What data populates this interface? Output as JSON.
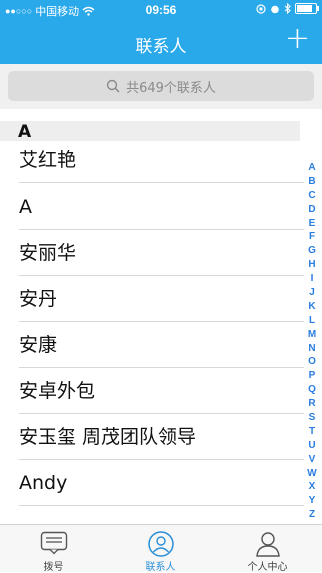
{
  "status_bar": {
    "signal": "●●○○○",
    "carrier": "中国移动",
    "time": "09:56"
  },
  "nav": {
    "title": "联系人",
    "add_label": "+"
  },
  "search": {
    "placeholder": "共649个联系人"
  },
  "section": {
    "letter": "A"
  },
  "contacts": [
    "艾红艳",
    "A",
    "安丽华",
    "安丹",
    "安康",
    "安卓外包",
    "安玉玺 周茂团队领导",
    "Andy"
  ],
  "index_letters": [
    "A",
    "B",
    "C",
    "D",
    "E",
    "F",
    "G",
    "H",
    "I",
    "J",
    "K",
    "L",
    "M",
    "N",
    "O",
    "P",
    "Q",
    "R",
    "S",
    "T",
    "U",
    "V",
    "W",
    "X",
    "Y",
    "Z",
    "#"
  ],
  "tabs": [
    {
      "label": "拨号",
      "icon": "dialpad-icon",
      "active": false
    },
    {
      "label": "联系人",
      "icon": "contacts-icon",
      "active": true
    },
    {
      "label": "个人中心",
      "icon": "profile-icon",
      "active": false
    }
  ],
  "colors": {
    "accent": "#29a8ea",
    "index": "#2a7de1",
    "active_tab": "#2a8fd8"
  }
}
